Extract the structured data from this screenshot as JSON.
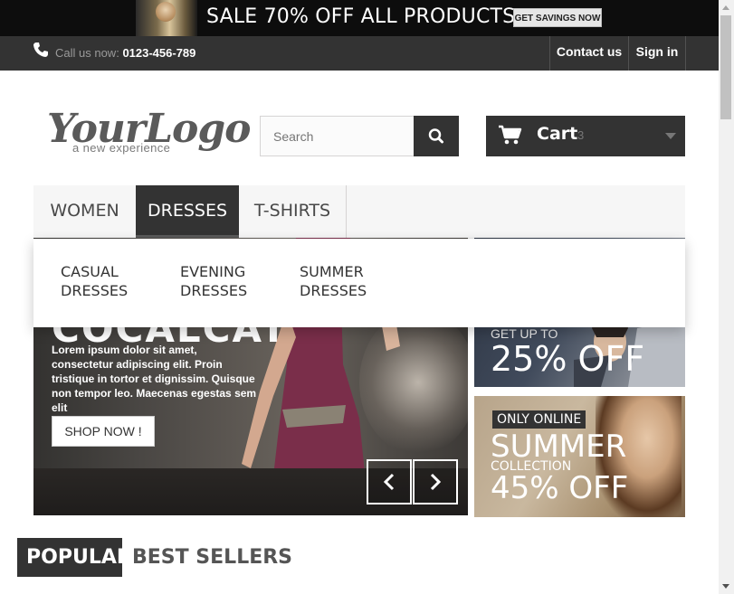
{
  "promo_banner": {
    "text": "SALE 70% OFF ALL PRODUCTS",
    "button": "GET SAVINGS NOW"
  },
  "header_nav": {
    "call_label": "Call us now:",
    "phone": "0123-456-789",
    "contact": "Contact us",
    "signin": "Sign in"
  },
  "logo": {
    "main": "YourLogo",
    "tagline": "a new experience"
  },
  "search": {
    "placeholder": "Search"
  },
  "cart": {
    "label": "Cart",
    "quantity": "3"
  },
  "menu": {
    "items": [
      "WOMEN",
      "DRESSES",
      "T-SHIRTS"
    ],
    "active": "DRESSES"
  },
  "submenu": {
    "items": [
      "CASUAL DRESSES",
      "EVENING DRESSES",
      "SUMMER DRESSES"
    ]
  },
  "slider": {
    "title": "COCALCAT",
    "description": "Lorem ipsum dolor sit amet, consectetur adipiscing elit. Proin tristique in tortor et dignissim. Quisque non tempor leo. Maecenas egestas sem elit",
    "button": "SHOP NOW !"
  },
  "promo_tiles": [
    {
      "kicker": "GET UP TO",
      "headline": "25% OFF"
    },
    {
      "badge": "ONLY ONLINE",
      "title": "SUMMER",
      "subtitle": "COLLECTION",
      "headline": "45% OFF"
    }
  ],
  "tabs": {
    "popular": "POPULAR",
    "best_sellers": "BEST SELLERS"
  },
  "colors": {
    "dark": "#333333",
    "text": "#484848",
    "border": "#d6d4d4"
  }
}
